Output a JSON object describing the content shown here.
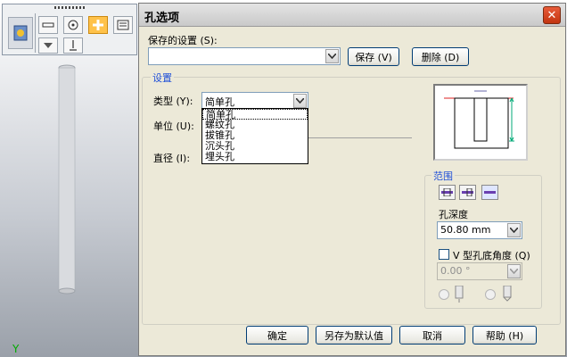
{
  "background": {
    "axis_label": "Y"
  },
  "dialog": {
    "title": "孔选项",
    "saved_settings_label": "保存的设置 (S):",
    "saved_settings_value": "",
    "save_button": "保存 (V)",
    "delete_button": "删除 (D)",
    "settings_group": "设置",
    "type_label": "类型 (Y):",
    "type_value": "简单孔",
    "type_options": [
      "简单孔",
      "螺纹孔",
      "拔锥孔",
      "沉头孔",
      "埋头孔"
    ],
    "unit_label": "单位 (U):",
    "diameter_label": "直径 (I):",
    "extent_group": "范围",
    "depth_label": "孔深度",
    "depth_value": "50.80 mm",
    "v_angle_label": "V 型孔底角度 (Q)",
    "v_angle_value": "0.00 °",
    "v_angle_checked": false,
    "ok_button": "确定",
    "save_default_button": "另存为默认值",
    "cancel_button": "取消",
    "help_button": "帮助 (H)"
  },
  "colors": {
    "accent": "#1f4fd8",
    "active_tool": "#ffc24a"
  }
}
